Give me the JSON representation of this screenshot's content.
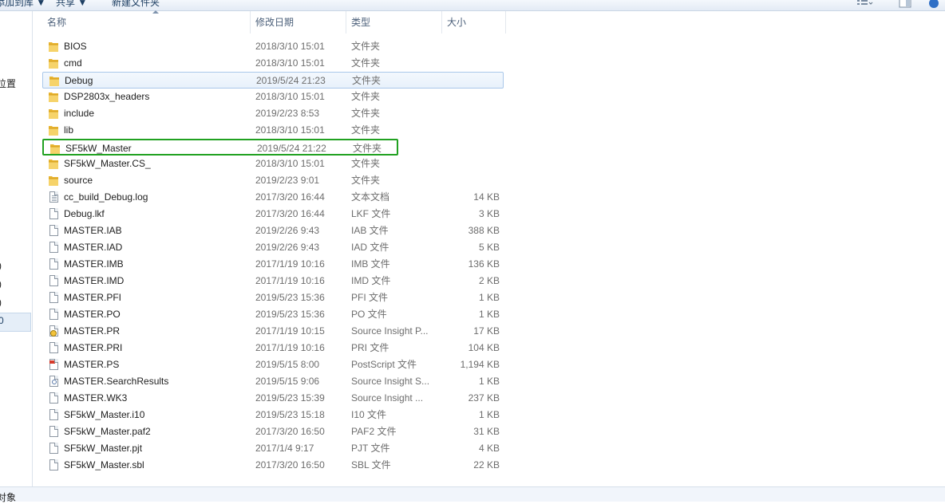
{
  "toolbar": {
    "items": [
      "添加到库 ▼",
      "共享 ▼",
      "新建文件夹"
    ],
    "icons": [
      "view-options-icon",
      "preview-pane-icon",
      "help-icon"
    ]
  },
  "nav": {
    "fragments": [
      "位置",
      ")",
      ")",
      ")",
      "0"
    ]
  },
  "columns": {
    "name": "名称",
    "date": "修改日期",
    "type": "类型",
    "size": "大小",
    "sort_column": "名称",
    "sort_direction": "ascending"
  },
  "files": [
    {
      "name": "BIOS",
      "date": "2018/3/10 15:01",
      "type": "文件夹",
      "size": "",
      "icon": "folder-icon"
    },
    {
      "name": "cmd",
      "date": "2018/3/10 15:01",
      "type": "文件夹",
      "size": "",
      "icon": "folder-icon"
    },
    {
      "name": "Debug",
      "date": "2019/5/24 21:23",
      "type": "文件夹",
      "size": "",
      "icon": "folder-icon",
      "selected": true
    },
    {
      "name": "DSP2803x_headers",
      "date": "2018/3/10 15:01",
      "type": "文件夹",
      "size": "",
      "icon": "folder-icon"
    },
    {
      "name": "include",
      "date": "2019/2/23 8:53",
      "type": "文件夹",
      "size": "",
      "icon": "folder-icon"
    },
    {
      "name": "lib",
      "date": "2018/3/10 15:01",
      "type": "文件夹",
      "size": "",
      "icon": "folder-icon"
    },
    {
      "name": "SF5kW_Master",
      "date": "2019/5/24 21:22",
      "type": "文件夹",
      "size": "",
      "icon": "folder-icon",
      "highlighted": true
    },
    {
      "name": "SF5kW_Master.CS_",
      "date": "2018/3/10 15:01",
      "type": "文件夹",
      "size": "",
      "icon": "folder-icon"
    },
    {
      "name": "source",
      "date": "2019/2/23 9:01",
      "type": "文件夹",
      "size": "",
      "icon": "folder-icon"
    },
    {
      "name": "cc_build_Debug.log",
      "date": "2017/3/20 16:44",
      "type": "文本文档",
      "size": "14 KB",
      "icon": "text-file-icon"
    },
    {
      "name": "Debug.lkf",
      "date": "2017/3/20 16:44",
      "type": "LKF 文件",
      "size": "3 KB",
      "icon": "file-icon"
    },
    {
      "name": "MASTER.IAB",
      "date": "2019/2/26 9:43",
      "type": "IAB 文件",
      "size": "388 KB",
      "icon": "file-icon"
    },
    {
      "name": "MASTER.IAD",
      "date": "2019/2/26 9:43",
      "type": "IAD 文件",
      "size": "5 KB",
      "icon": "file-icon"
    },
    {
      "name": "MASTER.IMB",
      "date": "2017/1/19 10:16",
      "type": "IMB 文件",
      "size": "136 KB",
      "icon": "file-icon"
    },
    {
      "name": "MASTER.IMD",
      "date": "2017/1/19 10:16",
      "type": "IMD 文件",
      "size": "2 KB",
      "icon": "file-icon"
    },
    {
      "name": "MASTER.PFI",
      "date": "2019/5/23 15:36",
      "type": "PFI 文件",
      "size": "1 KB",
      "icon": "file-icon"
    },
    {
      "name": "MASTER.PO",
      "date": "2019/5/23 15:36",
      "type": "PO 文件",
      "size": "1 KB",
      "icon": "file-icon"
    },
    {
      "name": "MASTER.PR",
      "date": "2017/1/19 10:15",
      "type": "Source Insight P...",
      "size": "17 KB",
      "icon": "source-insight-project-icon"
    },
    {
      "name": "MASTER.PRI",
      "date": "2017/1/19 10:16",
      "type": "PRI 文件",
      "size": "104 KB",
      "icon": "file-icon"
    },
    {
      "name": "MASTER.PS",
      "date": "2019/5/15 8:00",
      "type": "PostScript 文件",
      "size": "1,194 KB",
      "icon": "postscript-file-icon"
    },
    {
      "name": "MASTER.SearchResults",
      "date": "2019/5/15 9:06",
      "type": "Source Insight S...",
      "size": "1 KB",
      "icon": "search-results-file-icon"
    },
    {
      "name": "MASTER.WK3",
      "date": "2019/5/23 15:39",
      "type": "Source Insight ...",
      "size": "237 KB",
      "icon": "file-icon"
    },
    {
      "name": "SF5kW_Master.i10",
      "date": "2019/5/23 15:18",
      "type": "I10 文件",
      "size": "1 KB",
      "icon": "file-icon"
    },
    {
      "name": "SF5kW_Master.paf2",
      "date": "2017/3/20 16:50",
      "type": "PAF2 文件",
      "size": "31 KB",
      "icon": "file-icon"
    },
    {
      "name": "SF5kW_Master.pjt",
      "date": "2017/1/4 9:17",
      "type": "PJT 文件",
      "size": "4 KB",
      "icon": "file-icon"
    },
    {
      "name": "SF5kW_Master.sbl",
      "date": "2017/3/20 16:50",
      "type": "SBL 文件",
      "size": "22 KB",
      "icon": "file-icon"
    }
  ],
  "status": {
    "text": "对象"
  },
  "colors": {
    "highlight_border": "#21a121",
    "selection_border": "#a9c7ea",
    "selection_fill": "#e8f1fb"
  }
}
